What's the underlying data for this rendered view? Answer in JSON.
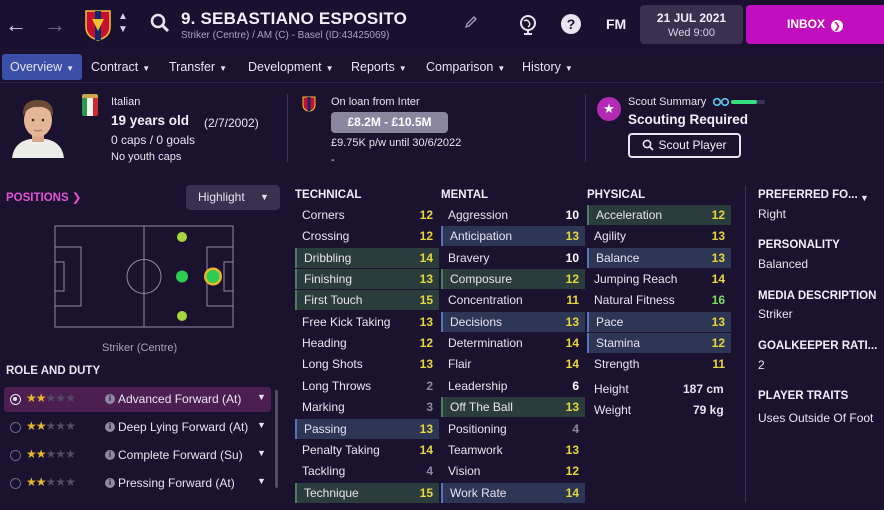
{
  "header": {
    "player_name": "9. SEBASTIANO ESPOSITO",
    "player_subtitle": "Striker (Centre) / AM (C) - Basel (ID:43425069)",
    "fm_label": "FM",
    "date_main": "21 JUL 2021",
    "date_sub": "Wed 9:00",
    "inbox_label": "INBOX"
  },
  "tabs": [
    {
      "label": "Overview"
    },
    {
      "label": "Contract"
    },
    {
      "label": "Transfer"
    },
    {
      "label": "Development"
    },
    {
      "label": "Reports"
    },
    {
      "label": "Comparison"
    },
    {
      "label": "History"
    }
  ],
  "info": {
    "nationality": "Italian",
    "age": "19 years old",
    "dob": "(2/7/2002)",
    "caps": "0 caps / 0 goals",
    "youth_caps": "No youth caps",
    "loan_status": "On loan from Inter",
    "value_range": "£8.2M - £10.5M",
    "wage": "£9.75K p/w until 30/6/2022",
    "dash": "-",
    "scout_summary_label": "Scout Summary",
    "scouting_status": "Scouting Required",
    "scout_button": "Scout Player",
    "scout_level": 0.75
  },
  "positions": {
    "title": "POSITIONS",
    "highlight_label": "Highlight",
    "caption": "Striker (Centre)"
  },
  "roles": {
    "title": "ROLE AND DUTY",
    "items": [
      {
        "label": "Advanced Forward (At)",
        "stars": 2,
        "selected": true
      },
      {
        "label": "Deep Lying Forward (At)",
        "stars": 2,
        "selected": false
      },
      {
        "label": "Complete Forward (Su)",
        "stars": 2,
        "selected": false
      },
      {
        "label": "Pressing Forward (At)",
        "stars": 2,
        "selected": false
      }
    ]
  },
  "technical": {
    "title": "TECHNICAL",
    "items": [
      {
        "name": "Corners",
        "value": "12",
        "hl": ""
      },
      {
        "name": "Crossing",
        "value": "12",
        "hl": ""
      },
      {
        "name": "Dribbling",
        "value": "14",
        "hl": "green"
      },
      {
        "name": "Finishing",
        "value": "13",
        "hl": "green"
      },
      {
        "name": "First Touch",
        "value": "15",
        "hl": "green"
      },
      {
        "name": "Free Kick Taking",
        "value": "13",
        "hl": ""
      },
      {
        "name": "Heading",
        "value": "12",
        "hl": ""
      },
      {
        "name": "Long Shots",
        "value": "13",
        "hl": ""
      },
      {
        "name": "Long Throws",
        "value": "2",
        "hl": ""
      },
      {
        "name": "Marking",
        "value": "3",
        "hl": ""
      },
      {
        "name": "Passing",
        "value": "13",
        "hl": "blue"
      },
      {
        "name": "Penalty Taking",
        "value": "14",
        "hl": ""
      },
      {
        "name": "Tackling",
        "value": "4",
        "hl": ""
      },
      {
        "name": "Technique",
        "value": "15",
        "hl": "green"
      }
    ]
  },
  "mental": {
    "title": "MENTAL",
    "items": [
      {
        "name": "Aggression",
        "value": "10",
        "hl": ""
      },
      {
        "name": "Anticipation",
        "value": "13",
        "hl": "blue"
      },
      {
        "name": "Bravery",
        "value": "10",
        "hl": ""
      },
      {
        "name": "Composure",
        "value": "12",
        "hl": "green"
      },
      {
        "name": "Concentration",
        "value": "11",
        "hl": ""
      },
      {
        "name": "Decisions",
        "value": "13",
        "hl": "blue"
      },
      {
        "name": "Determination",
        "value": "14",
        "hl": ""
      },
      {
        "name": "Flair",
        "value": "14",
        "hl": ""
      },
      {
        "name": "Leadership",
        "value": "6",
        "hl": ""
      },
      {
        "name": "Off The Ball",
        "value": "13",
        "hl": "green"
      },
      {
        "name": "Positioning",
        "value": "4",
        "hl": ""
      },
      {
        "name": "Teamwork",
        "value": "13",
        "hl": ""
      },
      {
        "name": "Vision",
        "value": "12",
        "hl": ""
      },
      {
        "name": "Work Rate",
        "value": "14",
        "hl": "blue"
      }
    ]
  },
  "physical": {
    "title": "PHYSICAL",
    "items": [
      {
        "name": "Acceleration",
        "value": "12",
        "hl": "green"
      },
      {
        "name": "Agility",
        "value": "13",
        "hl": ""
      },
      {
        "name": "Balance",
        "value": "13",
        "hl": "blue"
      },
      {
        "name": "Jumping Reach",
        "value": "14",
        "hl": ""
      },
      {
        "name": "Natural Fitness",
        "value": "16",
        "hl": ""
      },
      {
        "name": "Pace",
        "value": "13",
        "hl": "blue"
      },
      {
        "name": "Stamina",
        "value": "12",
        "hl": "blue"
      },
      {
        "name": "Strength",
        "value": "11",
        "hl": ""
      }
    ],
    "height_label": "Height",
    "height_value": "187 cm",
    "weight_label": "Weight",
    "weight_value": "79 kg"
  },
  "side": {
    "preferred_foot_label": "PREFERRED FO...",
    "preferred_foot": "Right",
    "personality_label": "PERSONALITY",
    "personality": "Balanced",
    "media_label": "MEDIA DESCRIPTION",
    "media": "Striker",
    "gk_label": "GOALKEEPER RATI...",
    "gk": "2",
    "traits_label": "PLAYER TRAITS",
    "traits": "Uses Outside Of Foot"
  },
  "colors": {
    "accent": "#c10fbd",
    "active_tab": "#3a50a8",
    "background": "#1b1230"
  }
}
